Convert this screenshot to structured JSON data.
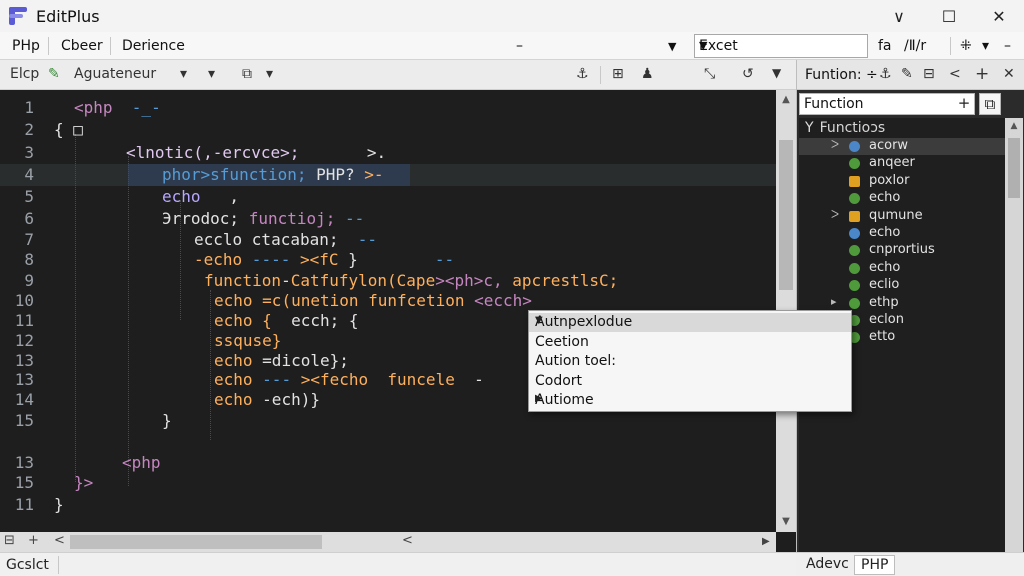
{
  "window": {
    "title": "EditPlus",
    "minimize": "∨",
    "maximize": "☐",
    "close": "✕"
  },
  "menubar": {
    "items": [
      "PHp",
      "Cbeer",
      "Derience"
    ],
    "dash": "–",
    "dropdown": "▼",
    "encode_value": "Excet",
    "right_tools": [
      "fa",
      "/Ⅱ/r",
      "⁜",
      "▾",
      "–"
    ]
  },
  "toolbar": {
    "tab_label": "Elcp",
    "doc_label": "Aguateneur",
    "dd1": "▾",
    "dd2": "▾",
    "tools": [
      "⧉",
      "▾",
      "⚓",
      "⊞",
      "♟",
      "⤡",
      "↺",
      "▼"
    ]
  },
  "editor": {
    "line_numbers": [
      "1",
      "2",
      "3",
      "4",
      "5",
      "6",
      "7",
      "8",
      "9",
      "10",
      "11",
      "12",
      "13",
      "13",
      "14",
      "15",
      "13",
      "15",
      "11"
    ],
    "lines": [
      [
        {
          "t": "<php",
          "c": "c-purple"
        },
        {
          "t": "  -_-",
          "c": "c-blue"
        }
      ],
      [
        {
          "t": "{",
          "c": "c-white"
        },
        {
          "t": " □",
          "c": "c-white"
        }
      ],
      [
        {
          "t": "<lnotic(,-ercvce>;",
          "c": "c-pink"
        },
        {
          "t": "       >.",
          "c": "c-white"
        }
      ],
      [
        {
          "t": "phor>sfunction; ",
          "c": "c-blue"
        },
        {
          "t": "PHP?",
          "c": "c-white"
        },
        {
          "t": " >-",
          "c": "c-orange"
        }
      ],
      [
        {
          "t": "echo",
          "c": "c-lav"
        },
        {
          "t": "   ,",
          "c": "c-white"
        }
      ],
      [
        {
          "t": "Эrrodoc; ",
          "c": "c-white"
        },
        {
          "t": "functioj;",
          "c": "c-purple"
        },
        {
          "t": " --",
          "c": "c-blue"
        }
      ],
      [
        {
          "t": "ecclo ",
          "c": "c-white"
        },
        {
          "t": "ctacaban;",
          "c": "c-white"
        },
        {
          "t": "  --",
          "c": "c-blue"
        }
      ],
      [
        {
          "t": "-echo",
          "c": "c-orange"
        },
        {
          "t": " ---- ",
          "c": "c-blue"
        },
        {
          "t": "><fC",
          "c": "c-orange"
        },
        {
          "t": " }",
          "c": "c-white"
        },
        {
          "t": "        --",
          "c": "c-blue"
        }
      ],
      [
        {
          "t": "function",
          "c": "c-orange"
        },
        {
          "t": "-",
          "c": "c-white"
        },
        {
          "t": "Catfufylon(Cape",
          "c": "c-orange"
        },
        {
          "t": "><ph>c,",
          "c": "c-purple"
        },
        {
          "t": " apcrestlsC;",
          "c": "c-orange"
        }
      ],
      [
        {
          "t": "echo ",
          "c": "c-orange"
        },
        {
          "t": "=c(unetion ",
          "c": "c-orange"
        },
        {
          "t": "funfcetion ",
          "c": "c-orange"
        },
        {
          "t": "<ecch>",
          "c": "c-purple"
        }
      ],
      [
        {
          "t": "echo {",
          "c": "c-orange"
        },
        {
          "t": "  ecch;",
          "c": "c-white"
        },
        {
          "t": " {",
          "c": "c-white"
        }
      ],
      [
        {
          "t": "ssquse}",
          "c": "c-orange"
        }
      ],
      [
        {
          "t": "echo ",
          "c": "c-orange"
        },
        {
          "t": "=dicole};",
          "c": "c-white"
        }
      ],
      [
        {
          "t": "echo ",
          "c": "c-orange"
        },
        {
          "t": "--- ",
          "c": "c-blue"
        },
        {
          "t": "><fecho ",
          "c": "c-orange"
        },
        {
          "t": " funcele",
          "c": "c-orange"
        },
        {
          "t": "  -",
          "c": "c-white"
        }
      ],
      [
        {
          "t": "echo ",
          "c": "c-orange"
        },
        {
          "t": "-ech)}",
          "c": "c-white"
        }
      ],
      [
        {
          "t": "}",
          "c": "c-white"
        }
      ],
      [],
      [
        {
          "t": "<php",
          "c": "c-purple"
        }
      ],
      [
        {
          "t": "}>",
          "c": "c-purple"
        }
      ],
      [
        {
          "t": "}",
          "c": "c-white"
        }
      ]
    ]
  },
  "popup": {
    "items": [
      "Autnpexlodue",
      "Ceetion",
      "Aution toel:",
      "Codort",
      "Autiome"
    ],
    "arrow_down": "▼",
    "arrow_right": "▶"
  },
  "panel": {
    "title": "Funtion: ÷",
    "tools": [
      "⚓",
      "✎",
      "⊟",
      "<",
      "+",
      "✕"
    ],
    "search_value": "Function",
    "search_add": "+",
    "search_opt": "⧉",
    "root_label": "Functioᴐs",
    "root_icon": "Y",
    "items": [
      {
        "label": "acorw",
        "dot": "blue",
        "exp": "ᐳ"
      },
      {
        "label": "anqeer",
        "dot": "green",
        "exp": ""
      },
      {
        "label": "poxlor",
        "dot": "orange",
        "exp": ""
      },
      {
        "label": "echo",
        "dot": "green",
        "exp": ""
      },
      {
        "label": "qumune",
        "dot": "orange",
        "exp": "ᐳ"
      },
      {
        "label": "echo",
        "dot": "blue",
        "exp": ""
      },
      {
        "label": "cnprortius",
        "dot": "green",
        "exp": ""
      },
      {
        "label": "echo",
        "dot": "green",
        "exp": ""
      },
      {
        "label": "eclio",
        "dot": "green",
        "exp": ""
      },
      {
        "label": "ethp",
        "dot": "green",
        "exp": "▸"
      },
      {
        "label": "eclon",
        "dot": "green",
        "exp": ""
      },
      {
        "label": "etto",
        "dot": "green",
        "exp": ""
      }
    ]
  },
  "statusbar": {
    "left": "Gcslct",
    "tabs": [
      "Adevc",
      "PHP"
    ]
  },
  "hstrip": {
    "buttons": [
      "⊟",
      "+",
      "<",
      "<",
      "▶"
    ]
  }
}
